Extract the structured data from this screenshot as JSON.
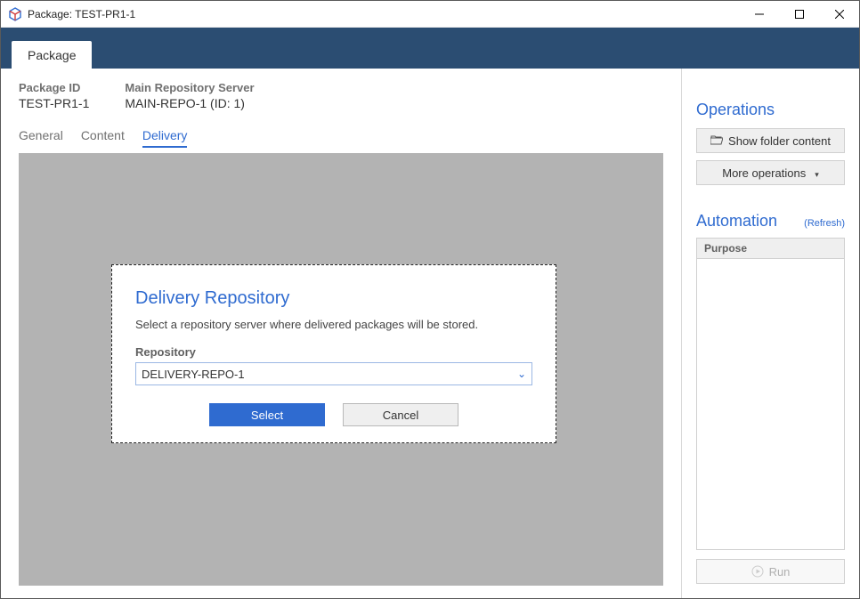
{
  "window": {
    "title": "Package: TEST-PR1-1"
  },
  "band": {
    "tab_label": "Package"
  },
  "meta": {
    "package_id_label": "Package ID",
    "package_id_value": "TEST-PR1-1",
    "main_repo_label": "Main Repository Server",
    "main_repo_value": "MAIN-REPO-1 (ID: 1)"
  },
  "tabs": {
    "general": "General",
    "content": "Content",
    "delivery": "Delivery"
  },
  "dialog": {
    "title": "Delivery Repository",
    "desc": "Select a repository server where delivered packages will be stored.",
    "repo_label": "Repository",
    "repo_value": "DELIVERY-REPO-1",
    "select_btn": "Select",
    "cancel_btn": "Cancel"
  },
  "ops": {
    "heading": "Operations",
    "show_folder": "Show folder content",
    "more": "More operations"
  },
  "auto": {
    "heading": "Automation",
    "refresh": "(Refresh)",
    "col_purpose": "Purpose",
    "run": "Run"
  }
}
